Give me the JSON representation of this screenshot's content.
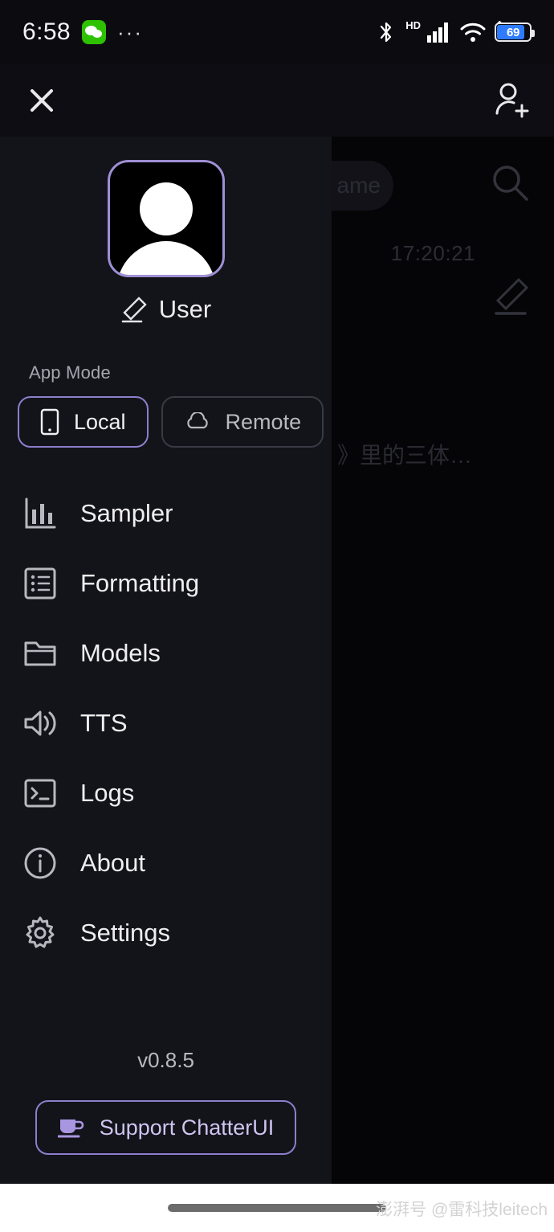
{
  "status_bar": {
    "time": "6:58",
    "app_badge_icon": "wechat-icon",
    "overflow_dots": "···",
    "bluetooth_icon": "bluetooth-icon",
    "network_type": "HD",
    "signal_icon": "cellular-signal-icon",
    "wifi_icon": "wifi-icon",
    "battery_level": "69",
    "battery_charging": true,
    "accent_blue": "#2f7bff",
    "wechat_green": "#2dc100"
  },
  "app_bar": {
    "close_icon": "close-icon",
    "add_user_icon": "add-user-icon"
  },
  "backdrop": {
    "search_pill_text": "ame",
    "search_icon": "search-icon",
    "timestamp": "17:20:21",
    "edit_icon": "edit-pencil-icon",
    "chat_preview": "》里的三体…"
  },
  "drawer": {
    "avatar_icon": "user-avatar-icon",
    "avatar_border_color": "#9f8fd4",
    "edit_name_icon": "edit-pencil-icon",
    "user_name": "User",
    "app_mode": {
      "label": "App Mode",
      "options": [
        {
          "label": "Local",
          "icon": "phone-icon",
          "selected": true
        },
        {
          "label": "Remote",
          "icon": "cloud-icon",
          "selected": false
        }
      ]
    },
    "menu_items": [
      {
        "label": "Sampler",
        "icon": "bar-chart-icon"
      },
      {
        "label": "Formatting",
        "icon": "list-icon"
      },
      {
        "label": "Models",
        "icon": "folder-icon"
      },
      {
        "label": "TTS",
        "icon": "speaker-icon"
      },
      {
        "label": "Logs",
        "icon": "terminal-icon"
      },
      {
        "label": "About",
        "icon": "info-circle-icon"
      },
      {
        "label": "Settings",
        "icon": "gear-icon"
      }
    ],
    "version": "v0.8.5",
    "support_button": {
      "label": "Support ChatterUI",
      "icon": "coffee-cup-icon"
    },
    "accent_purple": "#8d7ecb",
    "panel_bg": "#13131a"
  },
  "nav_bar": {
    "home_indicator": "home-indicator",
    "watermark": "澎湃号 @雷科技leitech"
  }
}
